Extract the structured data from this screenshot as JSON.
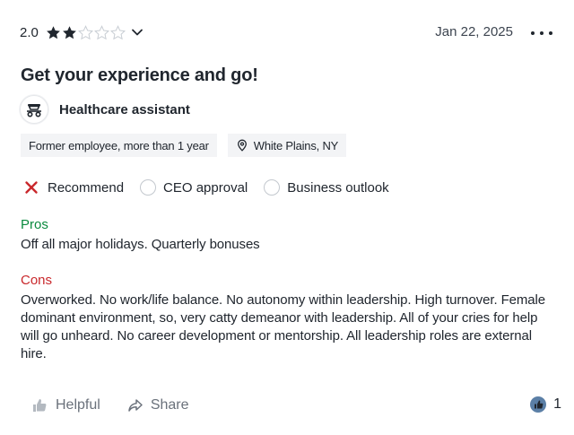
{
  "review": {
    "rating": "2.0",
    "rating_value": 2,
    "rating_max": 5,
    "date": "Jan 22, 2025",
    "title": "Get your experience and go!",
    "role": "Healthcare assistant",
    "employment": "Former employee, more than 1 year",
    "location": "White Plains, NY",
    "recommend_label": "Recommend",
    "ceo_label": "CEO approval",
    "outlook_label": "Business outlook",
    "pros_label": "Pros",
    "pros_text": "Off all major holidays. Quarterly bonuses",
    "cons_label": "Cons",
    "cons_text": "Overworked. No work/life balance. No autonomy within leadership. High turnover. Female dominant environment, so, very catty demeanor with leadership. All of your cries for help will go unheard. No career development or mentorship. All leadership roles are external hire.",
    "helpful_label": "Helpful",
    "share_label": "Share",
    "helpful_count": "1"
  },
  "colors": {
    "star_filled": "#20262e",
    "star_empty": "#c9ced4",
    "pros": "#0a8a3e",
    "cons": "#c9282c",
    "recommend_x": "#c9282c"
  },
  "icons": {
    "menu": "more-dots-icon",
    "dropdown": "chevron-down-icon",
    "role": "healthcare-icon",
    "location": "map-pin-icon",
    "recommend": "x-icon",
    "helpful": "thumbs-up-icon",
    "share": "share-icon",
    "reaction": "reaction-badge-icon"
  }
}
